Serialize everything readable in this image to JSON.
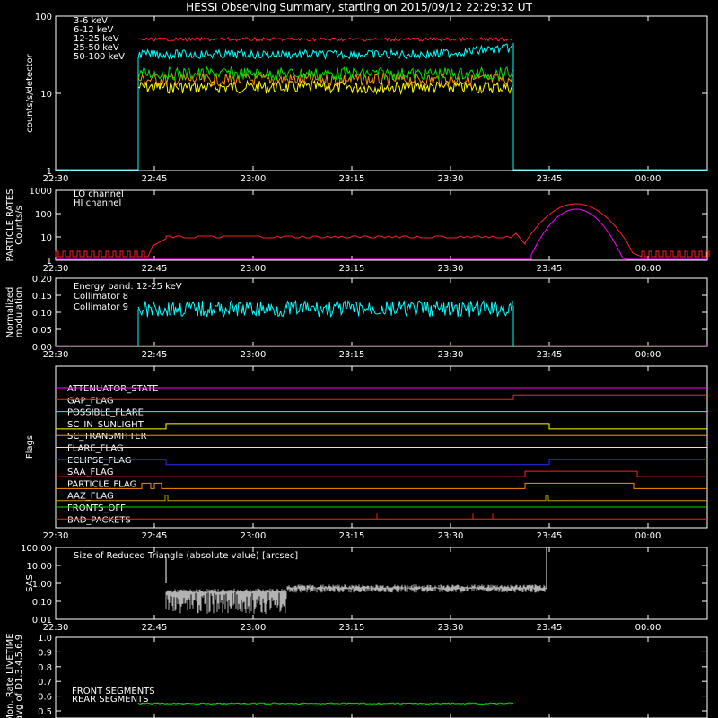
{
  "title": "HESSI Observing Summary, starting on 2015/09/12 22:29:32 UT",
  "x_ticks": [
    "22:30",
    "22:45",
    "23:00",
    "23:15",
    "23:30",
    "23:45",
    "00:00"
  ],
  "colors": {
    "red": "#ff2020",
    "orange": "#ff8c00",
    "yellow": "#ffff00",
    "green": "#00e000",
    "cyan": "#00ffff",
    "magenta": "#ff00ff",
    "white": "#ffffff",
    "blue": "#2a2aff"
  },
  "chart_data": [
    {
      "type": "line",
      "panel": "counts",
      "ylabel": "counts/s/detector",
      "yscale": "log",
      "ylim": [
        1,
        100
      ],
      "yticks": [
        "1",
        "10",
        "100"
      ],
      "x_range_min": [
        0,
        80
      ],
      "series": [
        {
          "name": "3-6 keV",
          "color": "#ff2020",
          "level": 50,
          "start": 15,
          "end": 75
        },
        {
          "name": "6-12 keV",
          "color": "#ff8c00",
          "level": 15,
          "start": 15,
          "end": 75
        },
        {
          "name": "12-25 keV",
          "color": "#ffff00",
          "level": 12,
          "start": 15,
          "end": 75
        },
        {
          "name": "25-50 keV",
          "color": "#00e000",
          "level": 18,
          "start": 15,
          "end": 75
        },
        {
          "name": "50-100 keV",
          "color": "#00ffff",
          "level": 32,
          "start": 15,
          "end": 75
        }
      ]
    },
    {
      "type": "line",
      "panel": "particle",
      "ylabel": "PARTICLE RATES Counts/s",
      "yscale": "log",
      "ylim": [
        1,
        1000
      ],
      "yticks": [
        "1",
        "10",
        "100",
        "1000"
      ],
      "series": [
        {
          "name": "LO channel",
          "color": "#ff2020"
        },
        {
          "name": "HI channel",
          "color": "#ff00ff"
        }
      ]
    },
    {
      "type": "line",
      "panel": "modulation",
      "ylabel": "Normalized modulation",
      "ylim": [
        0,
        0.2
      ],
      "yticks": [
        "0.00",
        "0.05",
        "0.10",
        "0.15",
        "0.20"
      ],
      "annotation": "Energy band: 12-25 keV",
      "series": [
        {
          "name": "Collimator 8",
          "color": "#00ffff",
          "level": 0.11
        },
        {
          "name": "Collimator 9",
          "color": "#ff00ff",
          "level": 0
        }
      ]
    },
    {
      "type": "line",
      "panel": "flags",
      "ylabel": "Flags",
      "series": [
        {
          "name": "ATTENUATOR_STATE",
          "color": "#ff00ff"
        },
        {
          "name": "GAP_FLAG",
          "color": "#ff2020"
        },
        {
          "name": "POSSIBLE_FLARE",
          "color": "#00ffff"
        },
        {
          "name": "SC_IN_SUNLIGHT",
          "color": "#ffff00"
        },
        {
          "name": "SC_TRANSMITTER",
          "color": "#ff8c00"
        },
        {
          "name": "FLARE_FLAG",
          "color": "#ffff00"
        },
        {
          "name": "ECLIPSE_FLAG",
          "color": "#2a2aff"
        },
        {
          "name": "SAA_FLAG",
          "color": "#ff2020"
        },
        {
          "name": "PARTICLE_FLAG",
          "color": "#ff8c00"
        },
        {
          "name": "AAZ_FLAG",
          "color": "#c8a000"
        },
        {
          "name": "FRONTS_OFF",
          "color": "#00e000"
        },
        {
          "name": "BAD_PACKETS",
          "color": "#ff2020"
        }
      ]
    },
    {
      "type": "line",
      "panel": "sas",
      "ylabel": "SAS",
      "yscale": "log",
      "ylim": [
        0.01,
        100
      ],
      "yticks": [
        "0.01",
        "0.10",
        "1.00",
        "10.00",
        "100.00"
      ],
      "annotation": "Size of Reduced Triangle (absolute value) [arcsec]",
      "series": [
        {
          "name": "",
          "color": "#ffffff"
        }
      ]
    },
    {
      "type": "line",
      "panel": "livetime",
      "ylabel": "Mon. Rate LIVETIME avg of D1,3,4,5,6,9",
      "ylim": [
        0.5,
        1.0
      ],
      "yticks": [
        "0.5",
        "0.6",
        "0.7",
        "0.8",
        "0.9",
        "1.0"
      ],
      "series": [
        {
          "name": "FRONT SEGMENTS",
          "color": "#00e000",
          "level": 0.55
        },
        {
          "name": "REAR SEGMENTS",
          "color": "#00a000",
          "level": 0.54
        }
      ]
    }
  ]
}
